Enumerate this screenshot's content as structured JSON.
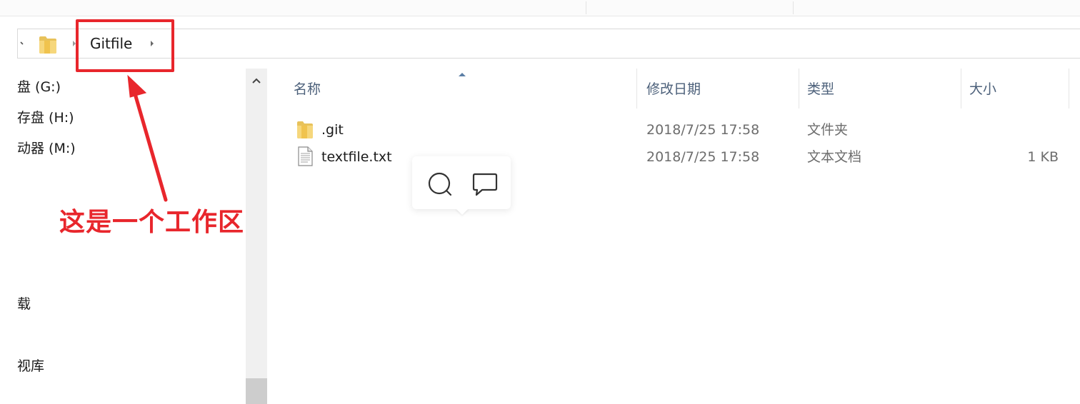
{
  "address_bar": {
    "breadcrumb": "Gitfile"
  },
  "annotation": {
    "text": "这是一个工作区",
    "color": "#e8262c"
  },
  "nav_pane": {
    "items": [
      {
        "label": "盘 (G:)",
        "icon": "drive-icon"
      },
      {
        "label": "存盘 (H:)",
        "icon": "drive-icon"
      },
      {
        "label": "动器 (M:)",
        "icon": "drive-icon"
      },
      {
        "label": "载",
        "icon": "downloads-icon"
      },
      {
        "label": "视库",
        "icon": "library-icon"
      }
    ]
  },
  "file_list": {
    "columns": {
      "name": "名称",
      "modified": "修改日期",
      "type": "类型",
      "size": "大小"
    },
    "rows": [
      {
        "name": ".git",
        "modified": "2018/7/25 17:58",
        "type": "文件夹",
        "size": "",
        "icon": "folder-icon"
      },
      {
        "name": "textfile.txt",
        "modified": "2018/7/25 17:58",
        "type": "文本文档",
        "size": "1 KB",
        "icon": "text-file-icon"
      }
    ]
  },
  "floating_toolbar": {
    "buttons": [
      {
        "icon": "search-icon"
      },
      {
        "icon": "comment-icon"
      }
    ]
  }
}
